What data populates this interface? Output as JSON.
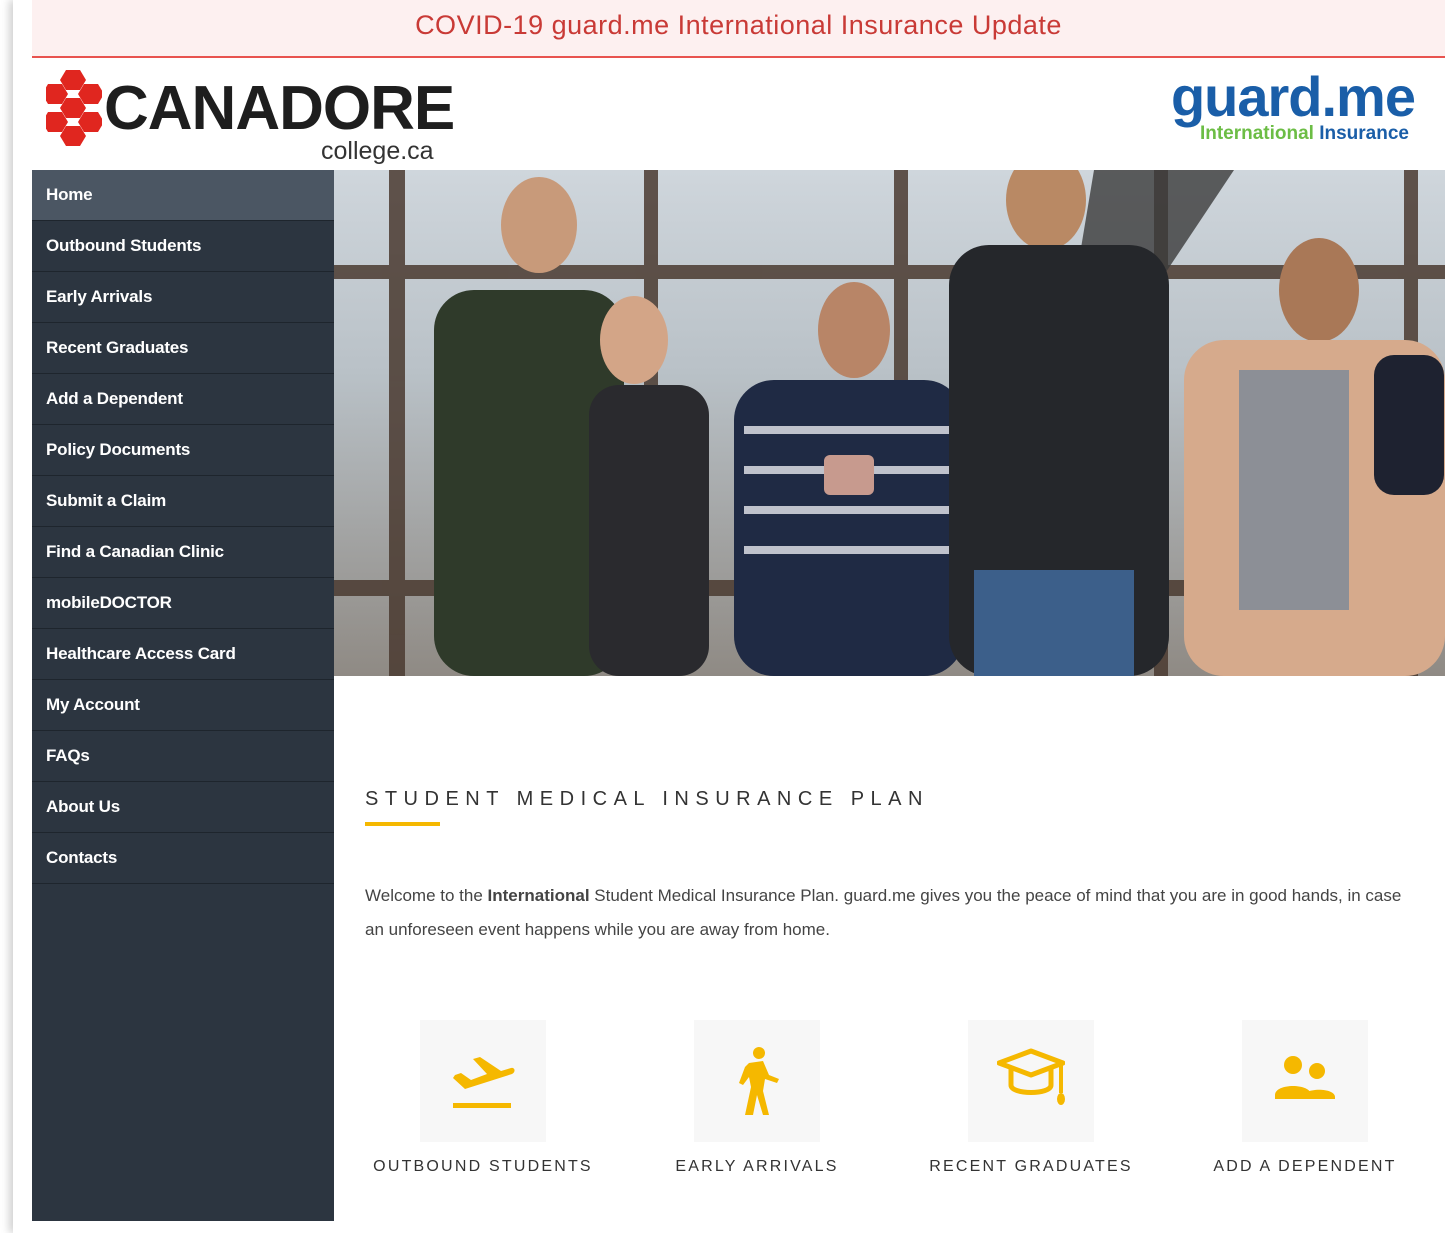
{
  "banner": {
    "text": "COVID-19 guard.me International Insurance Update"
  },
  "header": {
    "canadore_logo": {
      "word": "CANADORE",
      "sub": "college.ca"
    },
    "guardme_logo": {
      "word": "guard.me",
      "sub_part1": "International",
      "sub_part2": "Insurance"
    }
  },
  "sidebar": {
    "items": [
      {
        "label": "Home",
        "active": true
      },
      {
        "label": "Outbound Students"
      },
      {
        "label": "Early Arrivals"
      },
      {
        "label": "Recent Graduates"
      },
      {
        "label": "Add a Dependent"
      },
      {
        "label": "Policy Documents"
      },
      {
        "label": "Submit a Claim"
      },
      {
        "label": "Find a Canadian Clinic"
      },
      {
        "label": "mobileDOCTOR"
      },
      {
        "label": "Healthcare Access Card"
      },
      {
        "label": "My Account"
      },
      {
        "label": "FAQs"
      },
      {
        "label": "About Us"
      },
      {
        "label": "Contacts"
      }
    ]
  },
  "main": {
    "title": "STUDENT MEDICAL INSURANCE PLAN",
    "intro": {
      "before": "Welcome to the ",
      "bold": "International",
      "after": " Student Medical Insurance Plan. guard.me gives you the peace of mind that you are in good hands, in case an unforeseen event happens while you are away from home."
    },
    "quick_links": [
      {
        "label": "OUTBOUND STUDENTS",
        "icon": "airplane-departure-icon"
      },
      {
        "label": "EARLY ARRIVALS",
        "icon": "walking-person-icon"
      },
      {
        "label": "RECENT GRADUATES",
        "icon": "graduation-cap-icon"
      },
      {
        "label": "ADD A DEPENDENT",
        "icon": "people-icon"
      }
    ]
  },
  "colors": {
    "accent": "#f5b800",
    "sidebar_bg": "#2c3540",
    "sidebar_active": "#4b5663",
    "banner_text": "#c93a36",
    "canadore_red": "#e0261f",
    "guardme_blue": "#1a5ea8",
    "guardme_green": "#6cbd45"
  }
}
